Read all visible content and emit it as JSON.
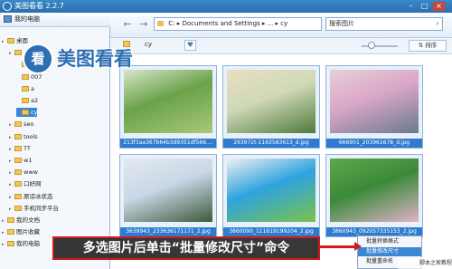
{
  "app": {
    "title": "美图看看 2.2.7"
  },
  "left_panel": {
    "header": "我的电脑",
    "tree": [
      {
        "label": "桌面",
        "indent": 0
      },
      {
        "label": "",
        "indent": 1
      },
      {
        "label": "4",
        "indent": 2
      },
      {
        "label": "007",
        "indent": 2
      },
      {
        "label": "a",
        "indent": 2
      },
      {
        "label": "a2",
        "indent": 2
      },
      {
        "label": "cy",
        "indent": 2
      },
      {
        "label": "seo",
        "indent": 1
      },
      {
        "label": "tools",
        "indent": 1
      },
      {
        "label": "TT",
        "indent": 1
      },
      {
        "label": "w1",
        "indent": 1
      },
      {
        "label": "www",
        "indent": 1
      },
      {
        "label": "口好网",
        "indent": 1
      },
      {
        "label": "原谅冰状态",
        "indent": 1
      },
      {
        "label": "手机同步平台",
        "indent": 1
      },
      {
        "label": "我的文档",
        "indent": 0
      },
      {
        "label": "图片收藏",
        "indent": 0
      },
      {
        "label": "我的电脑",
        "indent": 0
      }
    ],
    "selected_index": 6
  },
  "toolbar": {
    "address": "C: ▸ Documents and Settings ▸ ... ▸ cy",
    "search_placeholder": "搜索图片"
  },
  "subbar": {
    "folder_name": "cy",
    "sort_label": "排序"
  },
  "thumbnails": [
    {
      "caption": "213f3aa367b64b3d9351df566....",
      "colors": [
        "#6aa24a",
        "#a8c878",
        "#d9e5c9"
      ]
    },
    {
      "caption": "293972t-1163583613_d.jpg",
      "colors": [
        "#cfd8b8",
        "#4f7a3a",
        "#e8e0c0"
      ]
    },
    {
      "caption": "666901_203961678_d.jpg",
      "colors": [
        "#d9a6c7",
        "#6a7a8f",
        "#e8cfd8"
      ]
    },
    {
      "caption": "3639943_233636171171_2.jpg",
      "colors": [
        "#c9d7e6",
        "#3d5a3a",
        "#e3e9f0"
      ]
    },
    {
      "caption": "3860090_111619199204_2.jpg",
      "colors": [
        "#2ea3e0",
        "#7bc24a",
        "#f0f0f0"
      ]
    },
    {
      "caption": "3860943_092057335153_2.jpg",
      "colors": [
        "#3a8a3a",
        "#e0b2c8",
        "#5fa84a"
      ]
    }
  ],
  "context_menu": {
    "items": [
      "批量转换格式",
      "批量修改尺寸",
      "批量重命名"
    ],
    "highlight_index": 1
  },
  "annotation": {
    "text": "多选图片后单击“批量修改尺寸”命令",
    "overlay_logo": "美图看看"
  },
  "watermark": "脚本之家教程"
}
